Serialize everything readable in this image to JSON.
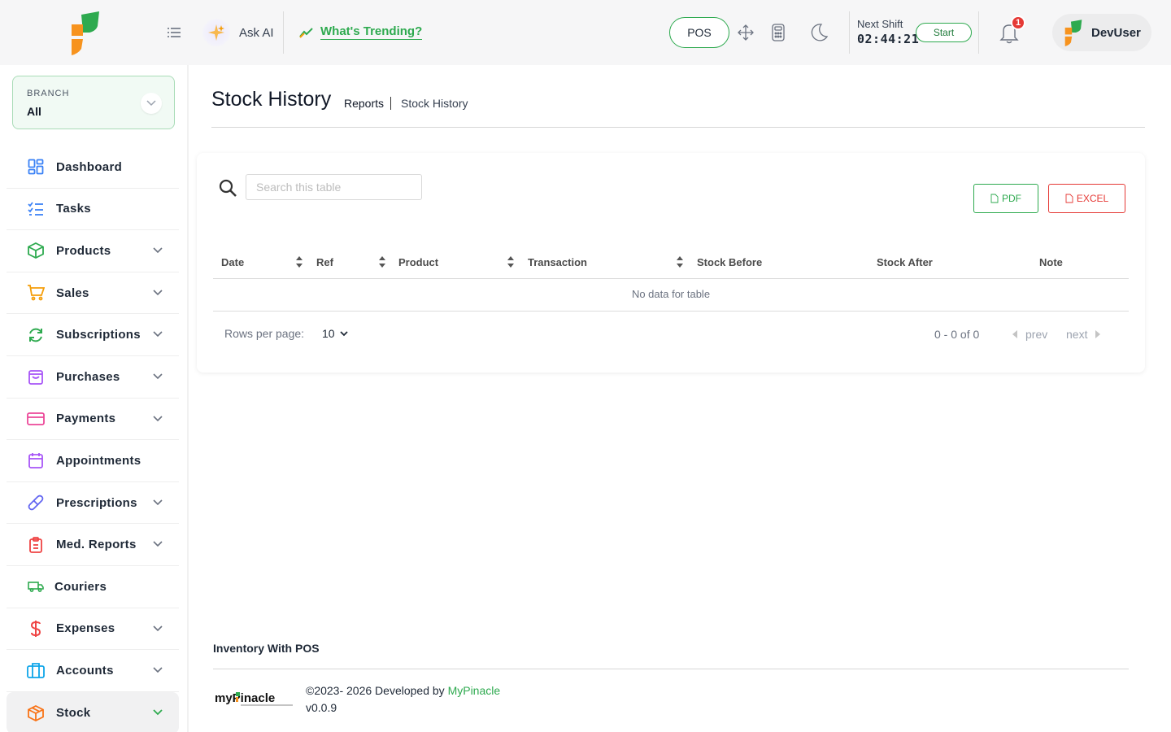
{
  "header": {
    "ask_ai_label": "Ask AI",
    "trending_label": "What's Trending?",
    "pos_label": "POS",
    "shift_label": "Next Shift",
    "shift_time": "02:44:21",
    "start_label": "Start",
    "notification_count": "1",
    "user_name": "DevUser"
  },
  "branch": {
    "caption": "BRANCH",
    "value": "All"
  },
  "sidebar": {
    "items": [
      {
        "label": "Dashboard",
        "icon": "dashboard-icon",
        "color": "#3b82f6"
      },
      {
        "label": "Tasks",
        "icon": "tasks-icon",
        "color": "#3b82f6"
      },
      {
        "label": "Products",
        "icon": "box-icon",
        "color": "#2eaa4f"
      },
      {
        "label": "Sales",
        "icon": "cart-icon",
        "color": "#f59e0b"
      },
      {
        "label": "Subscriptions",
        "icon": "refresh-icon",
        "color": "#2eaa4f"
      },
      {
        "label": "Purchases",
        "icon": "bag-icon",
        "color": "#a855f7"
      },
      {
        "label": "Payments",
        "icon": "card-icon",
        "color": "#ec4899"
      },
      {
        "label": "Appointments",
        "icon": "calendar-icon",
        "color": "#a855f7"
      },
      {
        "label": "Prescriptions",
        "icon": "pill-icon",
        "color": "#6366f1"
      },
      {
        "label": "Med. Reports",
        "icon": "clipboard-icon",
        "color": "#ef4444"
      },
      {
        "label": "Couriers",
        "icon": "truck-icon",
        "color": "#2eaa4f"
      },
      {
        "label": "Expenses",
        "icon": "dollar-icon",
        "color": "#ef4444"
      },
      {
        "label": "Accounts",
        "icon": "briefcase-icon",
        "color": "#0ea5e9"
      },
      {
        "label": "Stock",
        "icon": "stock-box-icon",
        "color": "#f97316"
      }
    ]
  },
  "page": {
    "title": "Stock History",
    "breadcrumb_parent": "Reports",
    "breadcrumb_current": "Stock History"
  },
  "table": {
    "search_placeholder": "Search this table",
    "pdf_label": "PDF",
    "excel_label": "EXCEL",
    "columns": [
      "Date",
      "Ref",
      "Product",
      "Transaction",
      "Stock Before",
      "Stock After",
      "Note"
    ],
    "empty_text": "No data for table",
    "rows_per_page_label": "Rows per page:",
    "rows_per_page_value": "10",
    "range_text": "0 - 0 of 0",
    "prev_label": "prev",
    "next_label": "next"
  },
  "footer": {
    "title": "Inventory With POS",
    "copyright_prefix": "©2023- 2026 Developed by ",
    "developer": "MyPinacle",
    "version": "v0.0.9"
  },
  "colors": {
    "accent_green": "#2eaa4f",
    "danger_red": "#e53935",
    "logo_orange": "#f7931e"
  }
}
